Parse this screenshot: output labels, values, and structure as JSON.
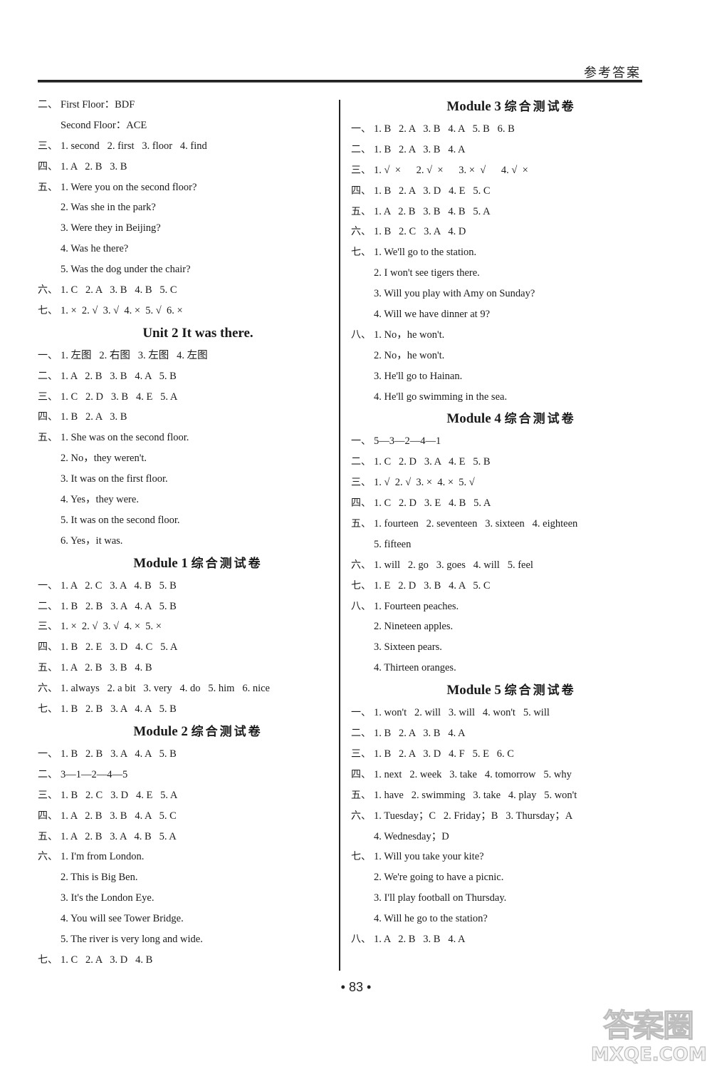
{
  "header": {
    "title": "参考答案"
  },
  "page_number": "• 83 •",
  "watermark": {
    "cn": "答案圈",
    "en": "MXQE.COM"
  },
  "left_column": [
    {
      "type": "line",
      "num": "二、",
      "text": "First Floor：BDF"
    },
    {
      "type": "cont",
      "text": "Second Floor：ACE"
    },
    {
      "type": "line",
      "num": "三、",
      "text": "1. second   2. first   3. floor   4. find"
    },
    {
      "type": "line",
      "num": "四、",
      "text": "1. A   2. B   3. B"
    },
    {
      "type": "line",
      "num": "五、",
      "text": "1. Were you on the second floor?"
    },
    {
      "type": "cont",
      "text": "2. Was she in the park?"
    },
    {
      "type": "cont",
      "text": "3. Were they in Beijing?"
    },
    {
      "type": "cont",
      "text": "4. Was he there?"
    },
    {
      "type": "cont",
      "text": "5. Was the dog under the chair?"
    },
    {
      "type": "line",
      "num": "六、",
      "text": "1. C   2. A   3. B   4. B   5. C"
    },
    {
      "type": "line",
      "num": "七、",
      "text": "1. ×  2. √  3. √  4. ×  5. √  6. ×"
    },
    {
      "type": "title",
      "en": "Unit 2    It was there.",
      "zh": ""
    },
    {
      "type": "line",
      "num": "一、",
      "text": "1. 左图   2. 右图   3. 左图   4. 左图"
    },
    {
      "type": "line",
      "num": "二、",
      "text": "1. A   2. B   3. B   4. A   5. B"
    },
    {
      "type": "line",
      "num": "三、",
      "text": "1. C   2. D   3. B   4. E   5. A"
    },
    {
      "type": "line",
      "num": "四、",
      "text": "1. B   2. A   3. B"
    },
    {
      "type": "line",
      "num": "五、",
      "text": "1. She was on the second floor."
    },
    {
      "type": "cont",
      "text": "2. No，they weren't."
    },
    {
      "type": "cont",
      "text": "3. It was on the first floor."
    },
    {
      "type": "cont",
      "text": "4. Yes，they were."
    },
    {
      "type": "cont",
      "text": "5. It was on the second floor."
    },
    {
      "type": "cont",
      "text": "6. Yes，it was."
    },
    {
      "type": "title",
      "en": "Module 1 ",
      "zh": "综合测试卷"
    },
    {
      "type": "line",
      "num": "一、",
      "text": "1. A   2. C   3. A   4. B   5. B"
    },
    {
      "type": "line",
      "num": "二、",
      "text": "1. B   2. B   3. A   4. A   5. B"
    },
    {
      "type": "line",
      "num": "三、",
      "text": "1. ×  2. √  3. √  4. ×  5. ×"
    },
    {
      "type": "line",
      "num": "四、",
      "text": "1. B   2. E   3. D   4. C   5. A"
    },
    {
      "type": "line",
      "num": "五、",
      "text": "1. A   2. B   3. B   4. B"
    },
    {
      "type": "line",
      "num": "六、",
      "text": "1. always   2. a bit   3. very   4. do   5. him   6. nice"
    },
    {
      "type": "line",
      "num": "七、",
      "text": "1. B   2. B   3. A   4. A   5. B"
    },
    {
      "type": "title",
      "en": "Module 2 ",
      "zh": "综合测试卷"
    },
    {
      "type": "line",
      "num": "一、",
      "text": "1. B   2. B   3. A   4. A   5. B"
    },
    {
      "type": "line",
      "num": "二、",
      "text": "3—1—2—4—5"
    },
    {
      "type": "line",
      "num": "三、",
      "text": "1. B   2. C   3. D   4. E   5. A"
    },
    {
      "type": "line",
      "num": "四、",
      "text": "1. A   2. B   3. B   4. A   5. C"
    },
    {
      "type": "line",
      "num": "五、",
      "text": "1. A   2. B   3. A   4. B   5. A"
    },
    {
      "type": "line",
      "num": "六、",
      "text": "1. I'm from London."
    },
    {
      "type": "cont",
      "text": "2. This is Big Ben."
    },
    {
      "type": "cont",
      "text": "3. It's the London Eye."
    },
    {
      "type": "cont",
      "text": "4. You will see Tower Bridge."
    },
    {
      "type": "cont",
      "text": "5. The river is very long and wide."
    },
    {
      "type": "line",
      "num": "七、",
      "text": "1. C   2. A   3. D   4. B"
    }
  ],
  "right_column": [
    {
      "type": "title",
      "en": "Module 3 ",
      "zh": "综合测试卷"
    },
    {
      "type": "line",
      "num": "一、",
      "text": "1. B   2. A   3. B   4. A   5. B   6. B"
    },
    {
      "type": "line",
      "num": "二、",
      "text": "1. B   2. A   3. B   4. A"
    },
    {
      "type": "line",
      "num": "三、",
      "text": "1. √  ×      2. √  ×      3. ×  √      4. √  ×"
    },
    {
      "type": "line",
      "num": "四、",
      "text": "1. B   2. A   3. D   4. E   5. C"
    },
    {
      "type": "line",
      "num": "五、",
      "text": "1. A   2. B   3. B   4. B   5. A"
    },
    {
      "type": "line",
      "num": "六、",
      "text": "1. B   2. C   3. A   4. D"
    },
    {
      "type": "line",
      "num": "七、",
      "text": "1. We'll go to the station."
    },
    {
      "type": "cont",
      "text": "2. I won't see tigers there."
    },
    {
      "type": "cont",
      "text": "3. Will you play with Amy on Sunday?"
    },
    {
      "type": "cont",
      "text": "4. Will we have dinner at 9?"
    },
    {
      "type": "line",
      "num": "八、",
      "text": "1. No，he won't."
    },
    {
      "type": "cont",
      "text": "2. No，he won't."
    },
    {
      "type": "cont",
      "text": "3. He'll go to Hainan."
    },
    {
      "type": "cont",
      "text": "4. He'll go swimming in the sea."
    },
    {
      "type": "title",
      "en": "Module 4 ",
      "zh": "综合测试卷"
    },
    {
      "type": "line",
      "num": "一、",
      "text": "5—3—2—4—1"
    },
    {
      "type": "line",
      "num": "二、",
      "text": "1. C   2. D   3. A   4. E   5. B"
    },
    {
      "type": "line",
      "num": "三、",
      "text": "1. √  2. √  3. ×  4. ×  5. √"
    },
    {
      "type": "line",
      "num": "四、",
      "text": "1. C   2. D   3. E   4. B   5. A"
    },
    {
      "type": "line",
      "num": "五、",
      "text": "1. fourteen   2. seventeen   3. sixteen   4. eighteen"
    },
    {
      "type": "cont",
      "text": "5. fifteen"
    },
    {
      "type": "line",
      "num": "六、",
      "text": "1. will   2. go   3. goes   4. will   5. feel"
    },
    {
      "type": "line",
      "num": "七、",
      "text": "1. E   2. D   3. B   4. A   5. C"
    },
    {
      "type": "line",
      "num": "八、",
      "text": "1. Fourteen peaches."
    },
    {
      "type": "cont",
      "text": "2. Nineteen apples."
    },
    {
      "type": "cont",
      "text": "3. Sixteen pears."
    },
    {
      "type": "cont",
      "text": "4. Thirteen oranges."
    },
    {
      "type": "title",
      "en": "Module 5 ",
      "zh": "综合测试卷"
    },
    {
      "type": "line",
      "num": "一、",
      "text": "1. won't   2. will   3. will   4. won't   5. will"
    },
    {
      "type": "line",
      "num": "二、",
      "text": "1. B   2. A   3. B   4. A"
    },
    {
      "type": "line",
      "num": "三、",
      "text": "1. B   2. A   3. D   4. F   5. E   6. C"
    },
    {
      "type": "line",
      "num": "四、",
      "text": "1. next   2. week   3. take   4. tomorrow   5. why"
    },
    {
      "type": "line",
      "num": "五、",
      "text": "1. have   2. swimming   3. take   4. play   5. won't"
    },
    {
      "type": "line",
      "num": "六、",
      "text": "1. Tuesday；C   2. Friday；B   3. Thursday；A"
    },
    {
      "type": "cont",
      "text": "4. Wednesday；D"
    },
    {
      "type": "line",
      "num": "七、",
      "text": "1. Will you take your kite?"
    },
    {
      "type": "cont",
      "text": "2. We're going to have a picnic."
    },
    {
      "type": "cont",
      "text": "3. I'll play football on Thursday."
    },
    {
      "type": "cont",
      "text": "4. Will he go to the station?"
    },
    {
      "type": "line",
      "num": "八、",
      "text": "1. A   2. B   3. B   4. A"
    }
  ]
}
